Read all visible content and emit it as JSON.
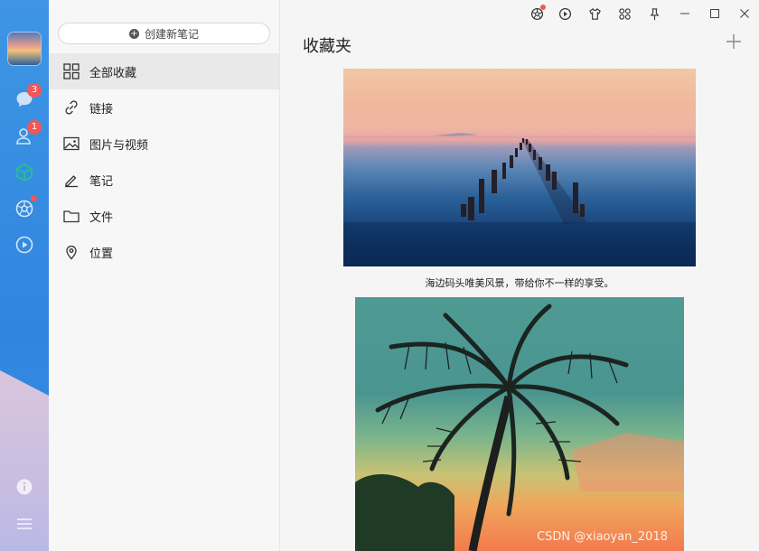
{
  "rail": {
    "badges": {
      "messages": "3",
      "contacts": "1"
    }
  },
  "sidebar": {
    "new_note_label": "创建新笔记",
    "items": [
      {
        "label": "全部收藏",
        "icon": "grid-icon"
      },
      {
        "label": "链接",
        "icon": "link-icon"
      },
      {
        "label": "图片与视频",
        "icon": "image-icon"
      },
      {
        "label": "笔记",
        "icon": "pen-icon"
      },
      {
        "label": "文件",
        "icon": "folder-icon"
      },
      {
        "label": "位置",
        "icon": "location-icon"
      }
    ]
  },
  "main": {
    "title": "收藏夹",
    "caption": "海边码头唯美风景，带给你不一样的享受。",
    "watermark": "CSDN @xiaoyan_2018"
  },
  "colors": {
    "accent": "#3a8fe0",
    "badge": "#f25757"
  }
}
